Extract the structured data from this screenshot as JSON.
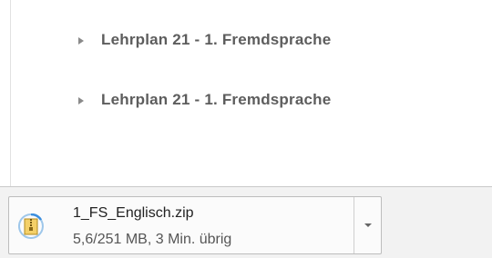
{
  "page": {
    "links": [
      {
        "label": "Lehrplan 21 - 1. Fremdsprache"
      },
      {
        "label": "Lehrplan 21 - 1. Fremdsprache"
      }
    ]
  },
  "download_bar": {
    "item": {
      "file_name": "1_FS_Englisch.zip",
      "status": "5,6/251 MB, 3 Min. übrig",
      "icon": "zip-archive-icon"
    }
  },
  "colors": {
    "link_text": "#5d5d5d",
    "bar_background": "#f2f2f2"
  }
}
